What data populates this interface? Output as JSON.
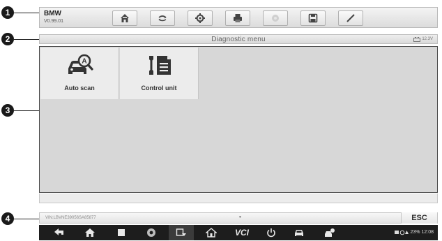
{
  "callouts": [
    "1",
    "2",
    "3",
    "4"
  ],
  "toolbar": {
    "vehicle_make": "BMW",
    "version": "V0.99.01",
    "buttons": [
      {
        "icon": "home-icon"
      },
      {
        "icon": "vehicle-swap-icon"
      },
      {
        "icon": "settings-gear-icon"
      },
      {
        "icon": "printer-icon"
      },
      {
        "icon": "help-icon"
      },
      {
        "icon": "save-icon"
      },
      {
        "icon": "pen-icon"
      }
    ]
  },
  "titlebar": {
    "title": "Diagnostic menu",
    "voltage": "12.3V"
  },
  "main": {
    "tiles": [
      {
        "label": "Auto scan",
        "icon": "auto-scan-icon"
      },
      {
        "label": "Control unit",
        "icon": "control-unit-icon"
      }
    ]
  },
  "footer": {
    "vin": "VIN:LBVNE39056SA85877",
    "indicator": "•",
    "esc_label": "ESC"
  },
  "navbar": {
    "vci_label": "VCI",
    "status_text": "23% 12:08",
    "buttons": [
      "back-icon",
      "home-icon",
      "recent-apps-icon",
      "browser-icon",
      "screenshot-icon",
      "autel-home-icon",
      "vci-icon",
      "power-icon",
      "car-icon",
      "shop-icon"
    ]
  },
  "colors": {
    "toolbar_bg": "#e6e6e6",
    "main_bg": "#d7d7d7",
    "navbar_bg": "#1d1d1d"
  }
}
